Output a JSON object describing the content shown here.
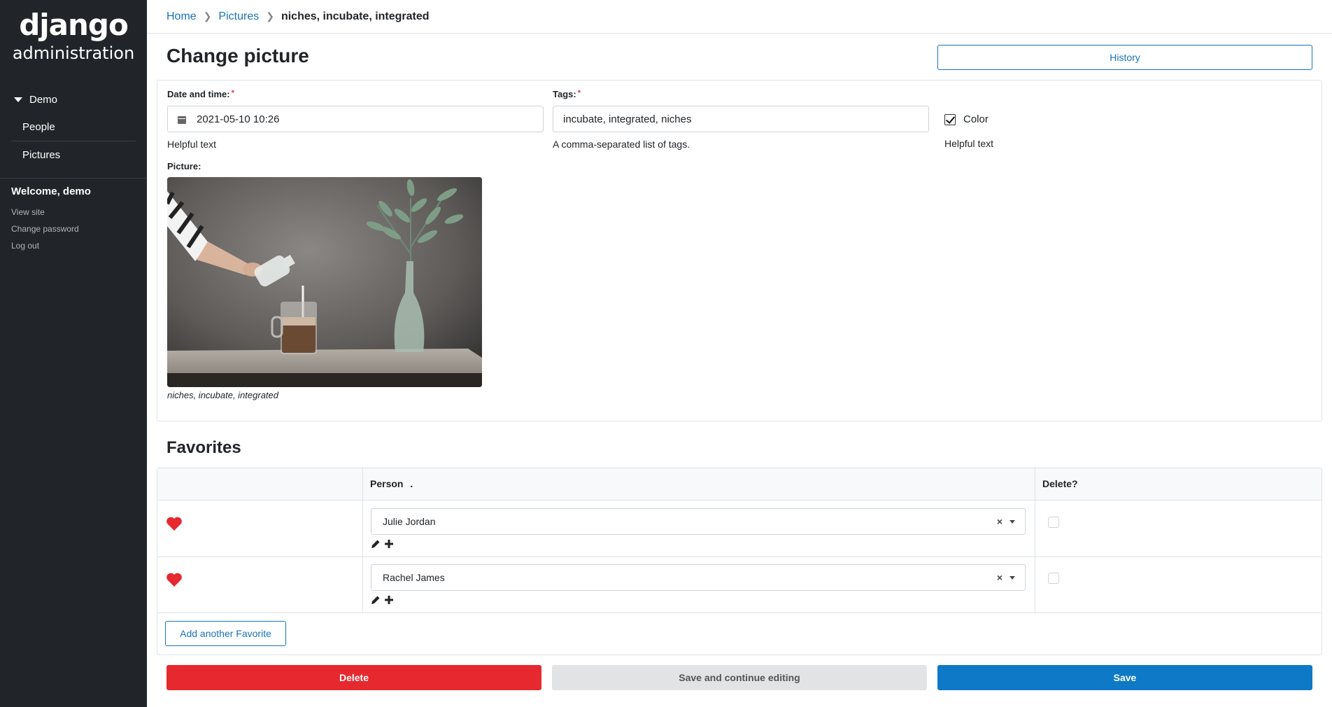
{
  "brand": {
    "name": "django",
    "subtitle": "administration"
  },
  "sidebar": {
    "group_label": "Demo",
    "items": [
      {
        "label": "People"
      },
      {
        "label": "Pictures"
      }
    ],
    "welcome": "Welcome, demo",
    "user_links": [
      "View site",
      "Change password",
      "Log out"
    ]
  },
  "breadcrumbs": {
    "home": "Home",
    "section": "Pictures",
    "current": "niches, incubate, integrated"
  },
  "page": {
    "title": "Change picture",
    "history_label": "History"
  },
  "form": {
    "datetime": {
      "label": "Date and time:",
      "required_mark": "*",
      "value": "2021-05-10 10:26",
      "help": "Helpful text"
    },
    "tags": {
      "label": "Tags:",
      "required_mark": "*",
      "value": "incubate, integrated, niches",
      "help": "A comma-separated list of tags."
    },
    "color": {
      "label": "Color",
      "checked": true,
      "help": "Helpful text"
    },
    "picture": {
      "label": "Picture:",
      "caption": "niches, incubate, integrated"
    }
  },
  "favorites": {
    "title": "Favorites",
    "columns": [
      "",
      "Person",
      "Delete?"
    ],
    "sort_marker": ".",
    "rows": [
      {
        "person": "Julie Jordan",
        "clear": "×"
      },
      {
        "person": "Rachel James",
        "clear": "×"
      }
    ],
    "add_label": "Add another Favorite"
  },
  "actions": {
    "delete": "Delete",
    "save_continue": "Save and continue editing",
    "save": "Save"
  },
  "colors": {
    "sidebar_bg": "#212529",
    "link": "#1a73b8",
    "delete": "#e5292f",
    "save": "#0e79c6",
    "heart": "#e5292f"
  },
  "icons": [
    "calendar-icon",
    "caret-down-icon",
    "chevron-right-icon",
    "heart-icon",
    "pencil-icon",
    "plus-icon",
    "clear-icon"
  ]
}
